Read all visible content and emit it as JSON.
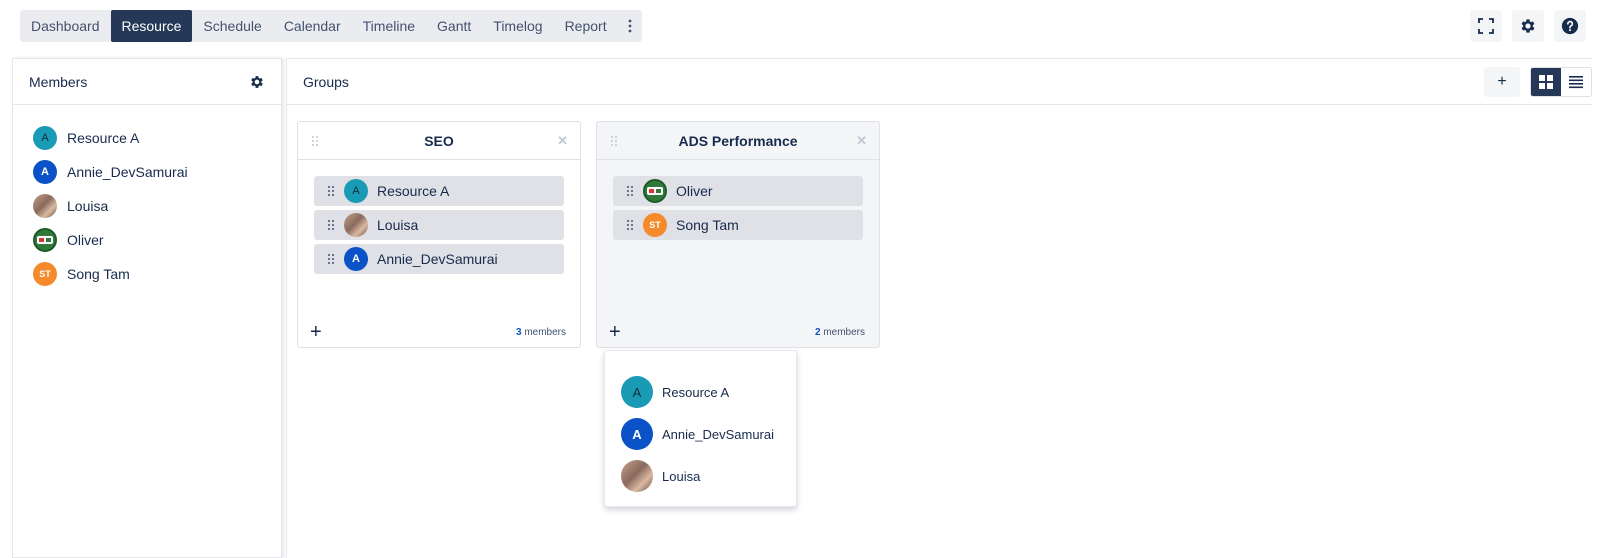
{
  "nav": {
    "tabs": [
      {
        "label": "Dashboard"
      },
      {
        "label": "Resource"
      },
      {
        "label": "Schedule"
      },
      {
        "label": "Calendar"
      },
      {
        "label": "Timeline"
      },
      {
        "label": "Gantt"
      },
      {
        "label": "Timelog"
      },
      {
        "label": "Report"
      }
    ],
    "active_tab": "Resource"
  },
  "top_actions": {
    "icons": [
      "fullscreen-icon",
      "gear-icon",
      "help-icon"
    ]
  },
  "members_panel": {
    "title": "Members",
    "members": [
      {
        "name": "Resource A",
        "initials": "A",
        "avatar_color": "#1a9bb5"
      },
      {
        "name": "Annie_DevSamurai",
        "initials": "A",
        "avatar_color": "#0b52c8"
      },
      {
        "name": "Louisa",
        "initials": "",
        "avatar_color": "photo"
      },
      {
        "name": "Oliver",
        "initials": "",
        "avatar_color": "#2f7a3a"
      },
      {
        "name": "Song Tam",
        "initials": "ST",
        "avatar_color": "#f48a2a"
      }
    ]
  },
  "groups_panel": {
    "title": "Groups",
    "add_label": "+",
    "view_modes": [
      "grid",
      "list"
    ],
    "active_view": "grid",
    "groups": [
      {
        "name": "SEO",
        "members": [
          {
            "name": "Resource A",
            "initials": "A"
          },
          {
            "name": "Louisa",
            "initials": ""
          },
          {
            "name": "Annie_DevSamurai",
            "initials": "A"
          }
        ],
        "count": "3",
        "count_label": "members",
        "add_label": "+"
      },
      {
        "name": "ADS Performance",
        "members": [
          {
            "name": "Oliver",
            "initials": ""
          },
          {
            "name": "Song Tam",
            "initials": "ST"
          }
        ],
        "count": "2",
        "count_label": "members",
        "add_label": "+"
      }
    ]
  },
  "add_member_dropdown": {
    "options": [
      {
        "name": "Resource A",
        "initials": "A"
      },
      {
        "name": "Annie_DevSamurai",
        "initials": "A"
      },
      {
        "name": "Louisa",
        "initials": ""
      }
    ]
  },
  "colors": {
    "accent_dark": "#253858",
    "text": "#172b4d",
    "count_blue": "#0b52c8"
  }
}
